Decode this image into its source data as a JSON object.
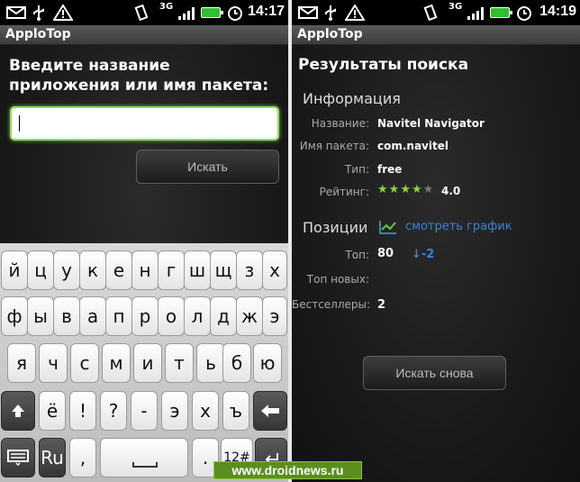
{
  "left": {
    "status": {
      "time": "14:17",
      "network": "3G"
    },
    "app_title": "ApploTop",
    "prompt": "Введите название приложения или имя пакета:",
    "search_input": {
      "value": "",
      "placeholder": ""
    },
    "search_button": "Искать",
    "keyboard": {
      "row1": [
        "й",
        "ц",
        "у",
        "к",
        "е",
        "н",
        "г",
        "ш",
        "щ",
        "з",
        "х"
      ],
      "row2": [
        "ф",
        "ы",
        "в",
        "а",
        "п",
        "р",
        "о",
        "л",
        "д",
        "ж",
        "э"
      ],
      "row3": [
        "я",
        "ч",
        "с",
        "м",
        "и",
        "т",
        "ь",
        "б",
        "ю"
      ],
      "row4": [
        "ё",
        "!",
        "?",
        "-",
        "э",
        "х",
        "ъ"
      ],
      "lang": "Ru",
      "comma": ",",
      "period": ".",
      "symbols": "12#"
    }
  },
  "right": {
    "status": {
      "time": "14:19",
      "network": "3G"
    },
    "app_title": "ApploTop",
    "heading": "Результаты поиска",
    "info_section": "Информация",
    "info": [
      {
        "label": "Название:",
        "value": "Navitel Navigator"
      },
      {
        "label": "Имя пакета:",
        "value": "com.navitel"
      },
      {
        "label": "Тип:",
        "value": "free"
      }
    ],
    "rating": {
      "label": "Рейтинг:",
      "stars": 4,
      "max": 5,
      "value": "4.0"
    },
    "positions_section": "Позиции",
    "chart_link": "смотреть график",
    "positions": [
      {
        "label": "Топ:",
        "value": "80",
        "delta": "↓-2"
      },
      {
        "label": "Топ новых:",
        "value": ""
      },
      {
        "label": "Бестселлеры:",
        "value": "2"
      }
    ],
    "search_again_button": "Искать снова"
  },
  "watermark": "www.droidnews.ru"
}
